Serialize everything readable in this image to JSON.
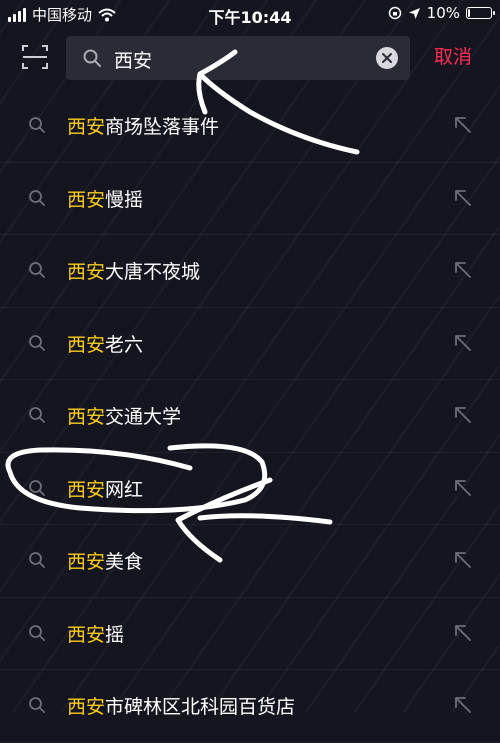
{
  "status_bar": {
    "carrier": "中国移动",
    "time": "下午10:44",
    "battery": "10%",
    "battery_level": 0.1
  },
  "search": {
    "query": "西安",
    "cancel_label": "取消"
  },
  "suggestions": [
    {
      "highlight": "西安",
      "rest": "商场坠落事件"
    },
    {
      "highlight": "西安",
      "rest": "慢摇"
    },
    {
      "highlight": "西安",
      "rest": "大唐不夜城"
    },
    {
      "highlight": "西安",
      "rest": "老六"
    },
    {
      "highlight": "西安",
      "rest": "交通大学"
    },
    {
      "highlight": "西安",
      "rest": "网红"
    },
    {
      "highlight": "西安",
      "rest": "美食"
    },
    {
      "highlight": "西安",
      "rest": "摇"
    },
    {
      "highlight": "西安",
      "rest": "市碑林区北科园百货店"
    }
  ],
  "colors": {
    "background": "#15151f",
    "highlight": "#facd1a",
    "cancel": "#fe2c55",
    "search_box": "#2b2b36"
  },
  "icons": [
    "scan-icon",
    "search-icon",
    "clear-icon",
    "fill-query-arrow-icon",
    "wifi-icon",
    "location-icon"
  ]
}
